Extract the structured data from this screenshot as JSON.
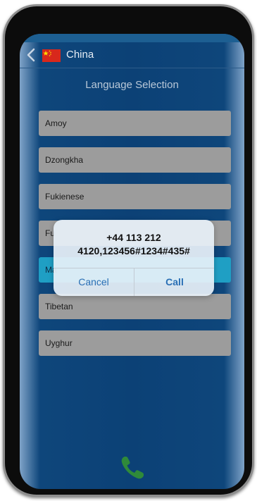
{
  "header": {
    "country": "China"
  },
  "title": "Language Selection",
  "languages": [
    {
      "label": "Amoy"
    },
    {
      "label": "Dzongkha"
    },
    {
      "label": "Fukienese"
    },
    {
      "label": "Fu"
    },
    {
      "label": "Ma"
    },
    {
      "label": "Tibetan"
    },
    {
      "label": "Uyghur"
    }
  ],
  "selected_language_index": 4,
  "alert": {
    "line1": "+44 113 212",
    "line2": "4120,123456#1234#435#",
    "cancel_label": "Cancel",
    "call_label": "Call"
  },
  "icons": {
    "back": "chevron-left-icon",
    "flag": "china-flag-icon",
    "call": "phone-icon"
  },
  "colors": {
    "screen_bg": "#0c4176",
    "list_item_bg": "#9c9c9c",
    "selected_item_bg": "#1f9fc4",
    "call_icon": "#2f8a3a",
    "alert_button": "#2a6fb5"
  }
}
